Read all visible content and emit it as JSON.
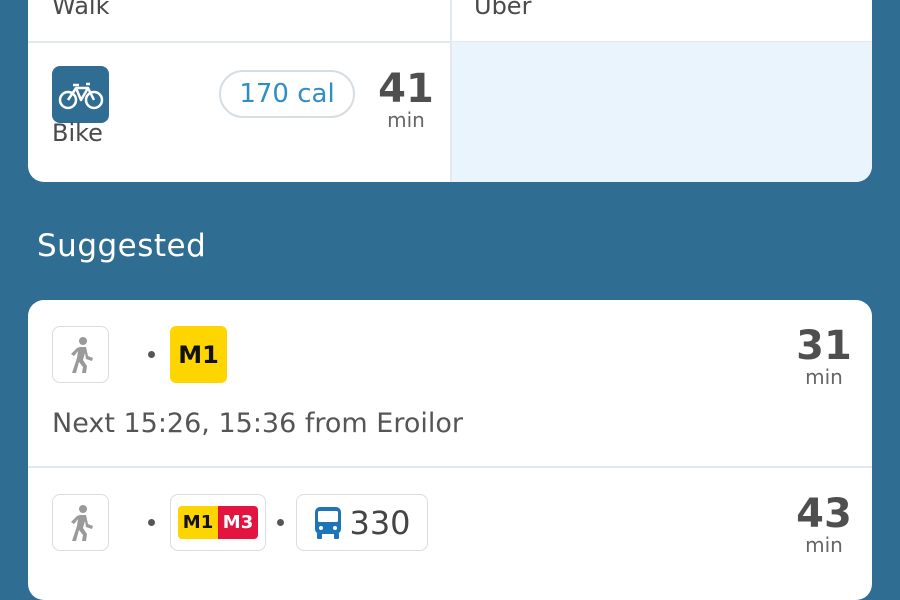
{
  "modes": {
    "walk": {
      "label": "Walk"
    },
    "uber": {
      "label": "Uber"
    },
    "bike": {
      "label": "Bike",
      "calories": "170 cal",
      "duration": "41",
      "unit": "min",
      "icon": "bike-icon"
    }
  },
  "suggested": {
    "title": "Suggested",
    "routes": [
      {
        "steps": [
          "walk-icon",
          "M1"
        ],
        "line": "M1",
        "duration": "31",
        "unit": "min",
        "next": "Next 15:26, 15:36 from Eroilor"
      },
      {
        "steps": [
          "walk-icon",
          "M1",
          "M3",
          "bus-icon",
          "330"
        ],
        "lines": [
          "M1",
          "M3"
        ],
        "bus": "330",
        "duration": "43",
        "unit": "min"
      }
    ]
  },
  "colors": {
    "background": "#2f6d93",
    "metro_m1": "#ffd500",
    "metro_m3": "#e3143f",
    "accent": "#2f8fc4"
  }
}
